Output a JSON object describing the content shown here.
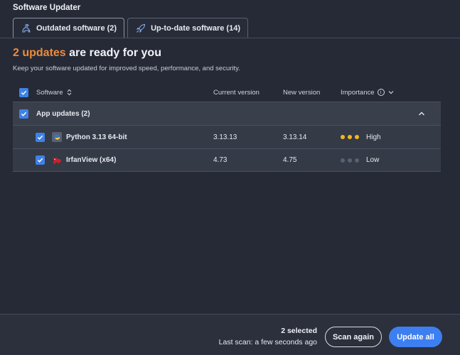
{
  "app": {
    "title": "Software Updater"
  },
  "tabs": [
    {
      "label": "Outdated software (2)",
      "icon": "dinosaur-icon",
      "active": true
    },
    {
      "label": "Up-to-date software (14)",
      "icon": "rocket-icon",
      "active": false
    }
  ],
  "headline": {
    "count_text": "2 updates",
    "rest_text": " are ready for you",
    "accent_color": "#f08a3a"
  },
  "subline": "Keep your software updated for improved speed, performance, and security.",
  "table": {
    "headers": {
      "software": "Software",
      "current": "Current version",
      "new": "New version",
      "importance": "Importance"
    },
    "group": {
      "label": "App updates (2)",
      "expanded": true
    },
    "rows": [
      {
        "name": "Python 3.13 64-bit",
        "icon": "python-icon",
        "current": "3.13.13",
        "new": "3.13.14",
        "importance": "High",
        "level": 3,
        "checked": true
      },
      {
        "name": "IrfanView (x64)",
        "icon": "irfanview-cat-icon",
        "current": "4.73",
        "new": "4.75",
        "importance": "Low",
        "level": 0,
        "checked": true
      }
    ]
  },
  "footer": {
    "selected": "2 selected",
    "last_scan": "Last scan: a few seconds ago",
    "scan_again": "Scan again",
    "update_all": "Update all"
  },
  "colors": {
    "accent_blue": "#3d7ff0",
    "dot_active": "#f2b81c",
    "dot_inactive": "#5a6070"
  }
}
